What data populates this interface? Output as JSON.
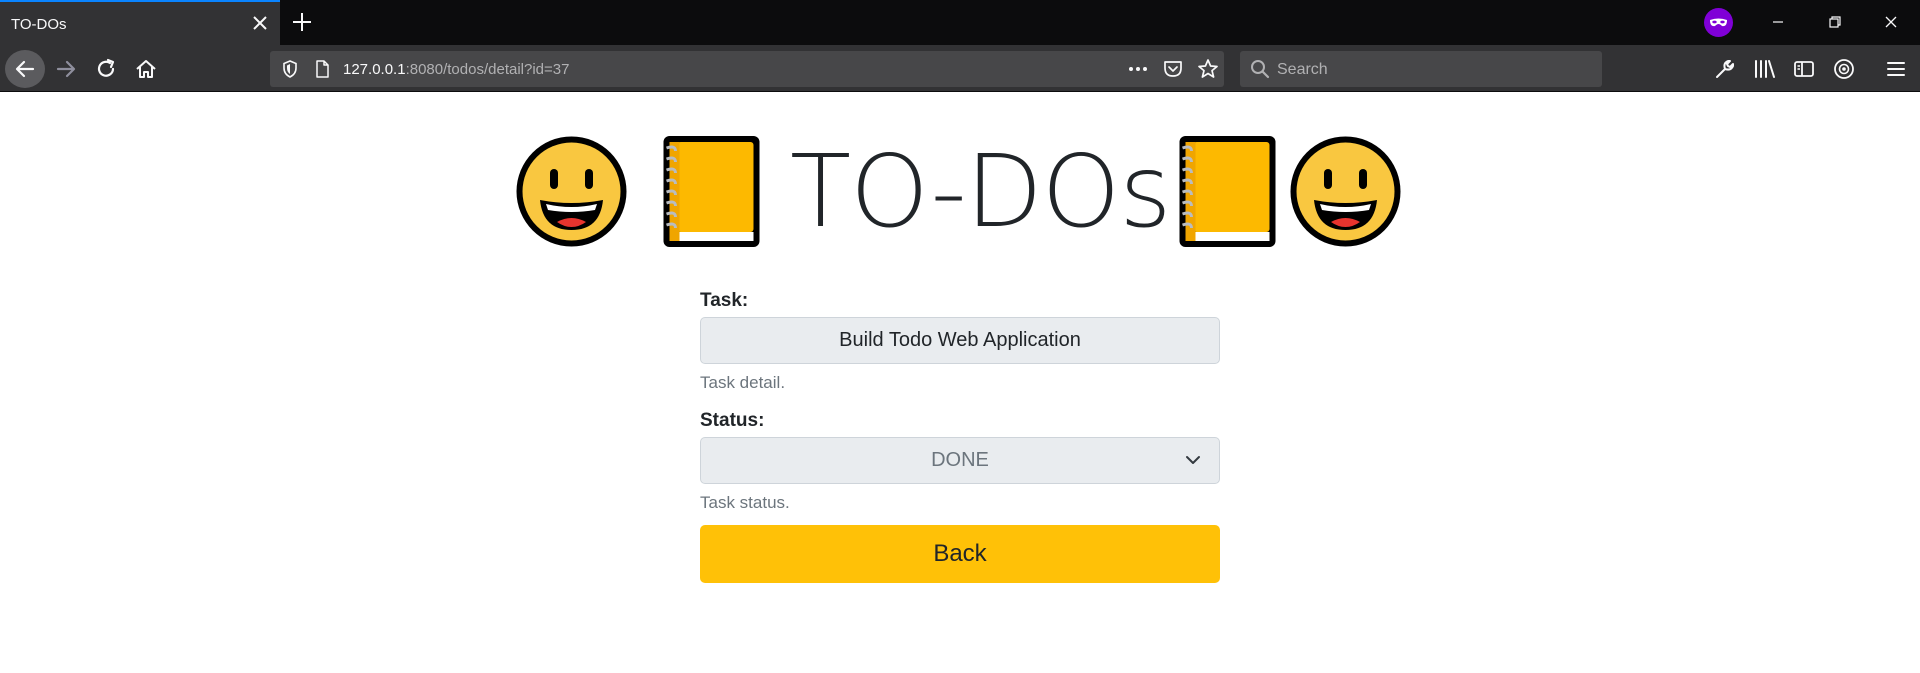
{
  "browser": {
    "tab": {
      "title": "TO-DOs"
    },
    "url": {
      "host": "127.0.0.1",
      "rest": ":8080/todos/detail?id=37"
    },
    "search": {
      "placeholder": "Search"
    },
    "icons": [
      "back-arrow-icon",
      "forward-arrow-icon",
      "reload-icon",
      "home-icon",
      "shield-icon",
      "page-icon",
      "more-icon",
      "pocket-icon",
      "star-icon",
      "search-icon",
      "wrench-icon",
      "library-icon",
      "sidebar-icon",
      "extension-icon",
      "menu-icon",
      "private-mask-icon"
    ]
  },
  "page": {
    "title": "TO-DOs",
    "emojis": [
      "grinning-face",
      "notebook",
      "notebook",
      "grinning-face"
    ],
    "task": {
      "label": "Task:",
      "value": "Build Todo Web Application",
      "help": "Task detail."
    },
    "status": {
      "label": "Status:",
      "value": "DONE",
      "help": "Task status."
    },
    "back_button": {
      "label": "Back"
    }
  },
  "colors": {
    "accent_yellow": "#ffc107",
    "chrome_dark": "#0c0c0d",
    "chrome_toolbar": "#323234",
    "private_purple": "#8000d7"
  }
}
